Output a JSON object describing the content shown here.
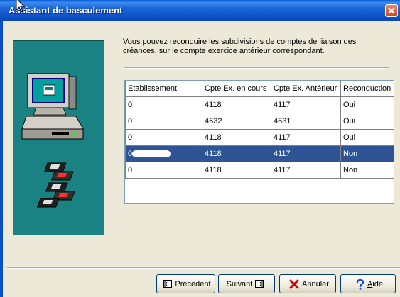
{
  "window": {
    "title": "Assistant de basculement"
  },
  "intro_text": "Vous pouvez reconduire les subdivisions de comptes de liaison des créances, sur le compte exercice antérieur correspondant.",
  "table": {
    "columns": [
      "Etablissement",
      "Cpte Ex. en cours",
      "Cpte Ex. Antérieur",
      "Reconduction"
    ],
    "rows": [
      {
        "etab": "0",
        "en_cours": "4118",
        "anterieur": "4117",
        "reconduction": "Oui"
      },
      {
        "etab": "0",
        "en_cours": "4632",
        "anterieur": "4631",
        "reconduction": "Oui"
      },
      {
        "etab": "0",
        "en_cours": "4118",
        "anterieur": "4117",
        "reconduction": "Oui"
      },
      {
        "etab": "0",
        "en_cours": "4118",
        "anterieur": "4117",
        "reconduction": "Non"
      },
      {
        "etab": "0",
        "en_cours": "4118",
        "anterieur": "4117",
        "reconduction": "Non"
      }
    ],
    "selected_row": 3
  },
  "buttons": {
    "precedent": "Précédent",
    "suivant": "Suivant",
    "annuler": "Annuler",
    "aide_first": "A",
    "aide_rest": "ide"
  },
  "icons": {
    "close": "close-icon",
    "computer": "computer-icon",
    "floppies": "floppy-disk-icon",
    "back": "back-arrow-icon",
    "next": "next-arrow-icon",
    "cancel": "red-x-icon",
    "help": "question-mark-icon"
  },
  "colors": {
    "titlebar": "#0b4fc4",
    "side_panel": "#1a8282",
    "selection": "#2f5496",
    "close_button": "#d2461e"
  }
}
